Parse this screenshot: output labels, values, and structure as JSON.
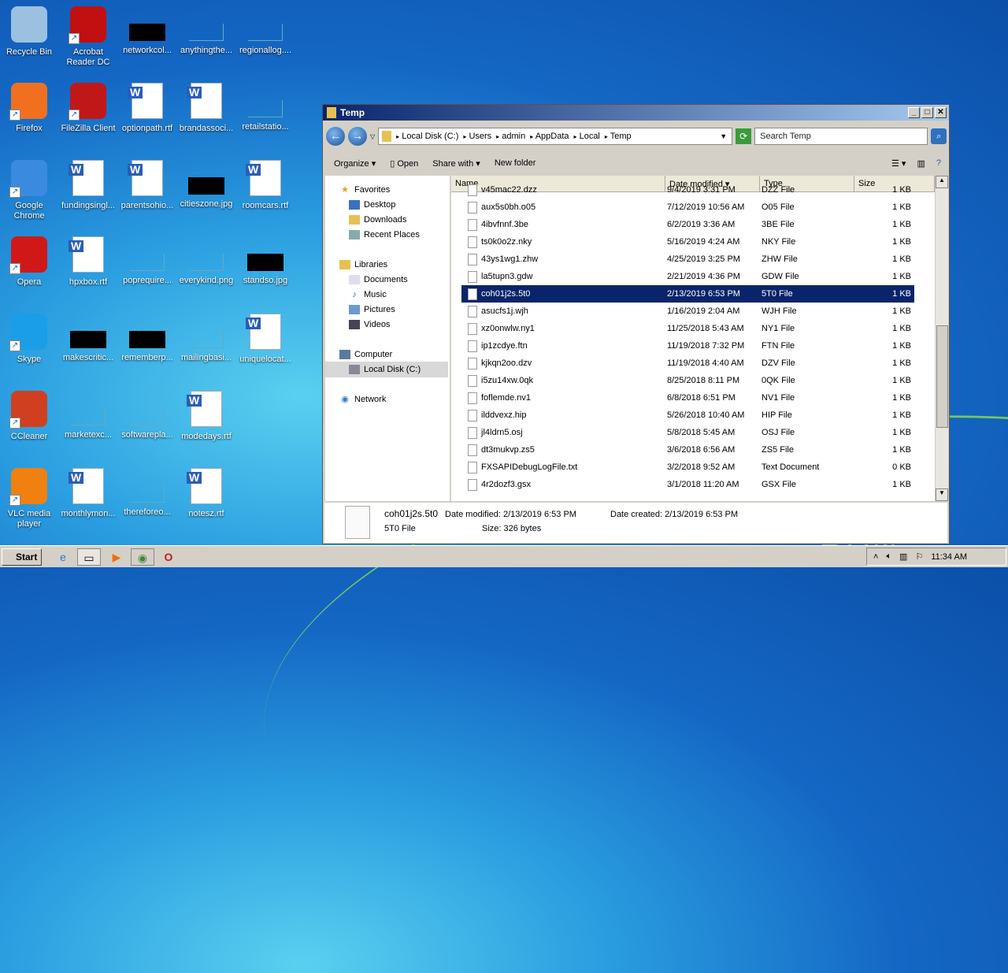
{
  "desktop": {
    "icons": [
      {
        "label": "Recycle Bin",
        "kind": "app",
        "color": "#9cc0e0"
      },
      {
        "label": "Acrobat Reader DC",
        "kind": "app",
        "color": "#c01010",
        "shortcut": true
      },
      {
        "label": "networkcol...",
        "kind": "black"
      },
      {
        "label": "anythingthe...",
        "kind": "blank"
      },
      {
        "label": "regionallog....",
        "kind": "blank"
      },
      {
        "label": "Firefox",
        "kind": "app",
        "color": "#f07020",
        "shortcut": true
      },
      {
        "label": "FileZilla Client",
        "kind": "app",
        "color": "#c01818",
        "shortcut": true
      },
      {
        "label": "optionpath.rtf",
        "kind": "doc"
      },
      {
        "label": "brandassoci...",
        "kind": "doc"
      },
      {
        "label": "retailstatio...",
        "kind": "blank"
      },
      {
        "label": "Google Chrome",
        "kind": "app",
        "color": "#3a8ae0",
        "shortcut": true
      },
      {
        "label": "fundingsingl...",
        "kind": "doc"
      },
      {
        "label": "parentsohio...",
        "kind": "doc"
      },
      {
        "label": "citieszone.jpg",
        "kind": "black"
      },
      {
        "label": "roomcars.rtf",
        "kind": "doc"
      },
      {
        "label": "Opera",
        "kind": "app",
        "color": "#d01818",
        "shortcut": true
      },
      {
        "label": "hpxbox.rtf",
        "kind": "doc"
      },
      {
        "label": "poprequire...",
        "kind": "blank"
      },
      {
        "label": "everykind.png",
        "kind": "blank"
      },
      {
        "label": "standso.jpg",
        "kind": "black"
      },
      {
        "label": "Skype",
        "kind": "app",
        "color": "#1a9ee8",
        "shortcut": true
      },
      {
        "label": "makescritic...",
        "kind": "black"
      },
      {
        "label": "rememberp...",
        "kind": "black"
      },
      {
        "label": "mailingbasi...",
        "kind": "blank"
      },
      {
        "label": "uniquelocat...",
        "kind": "doc"
      },
      {
        "label": "CCleaner",
        "kind": "app",
        "color": "#d04020",
        "shortcut": true
      },
      {
        "label": "marketexc...",
        "kind": "blank"
      },
      {
        "label": "softwarepla...",
        "kind": "blank"
      },
      {
        "label": "modedays.rtf",
        "kind": "doc"
      },
      null,
      {
        "label": "VLC media player",
        "kind": "app",
        "color": "#f08010",
        "shortcut": true
      },
      {
        "label": "monthlymon...",
        "kind": "doc"
      },
      {
        "label": "thereforeo...",
        "kind": "blank"
      },
      {
        "label": "notesz.rtf",
        "kind": "doc"
      },
      null
    ]
  },
  "window": {
    "title": "Temp",
    "breadcrumb": [
      "Local Disk (C:)",
      "Users",
      "admin",
      "AppData",
      "Local",
      "Temp"
    ],
    "search_placeholder": "Search Temp",
    "toolbar": {
      "organize": "Organize",
      "open": "Open",
      "share": "Share with",
      "new_folder": "New folder"
    },
    "nav": {
      "favorites": "Favorites",
      "desktop": "Desktop",
      "downloads": "Downloads",
      "recent": "Recent Places",
      "libraries": "Libraries",
      "documents": "Documents",
      "music": "Music",
      "pictures": "Pictures",
      "videos": "Videos",
      "computer": "Computer",
      "local_disk": "Local Disk (C:)",
      "network": "Network"
    },
    "columns": {
      "name": "Name",
      "date": "Date modified",
      "type": "Type",
      "size": "Size"
    },
    "files": [
      [
        "v45mac22.dzz",
        "9/4/2019 3:31 PM",
        "DZZ File",
        "1 KB"
      ],
      [
        "aux5s0bh.o05",
        "7/12/2019 10:56 AM",
        "O05 File",
        "1 KB"
      ],
      [
        "4ibvfnnf.3be",
        "6/2/2019 3:36 AM",
        "3BE File",
        "1 KB"
      ],
      [
        "ts0k0o2z.nky",
        "5/16/2019 4:24 AM",
        "NKY File",
        "1 KB"
      ],
      [
        "43ys1wg1.zhw",
        "4/25/2019 3:25 PM",
        "ZHW File",
        "1 KB"
      ],
      [
        "la5tupn3.gdw",
        "2/21/2019 4:36 PM",
        "GDW File",
        "1 KB"
      ],
      [
        "coh01j2s.5t0",
        "2/13/2019 6:53 PM",
        "5T0 File",
        "1 KB"
      ],
      [
        "asucfs1j.wjh",
        "1/16/2019 2:04 AM",
        "WJH File",
        "1 KB"
      ],
      [
        "xz0onwlw.ny1",
        "11/25/2018 5:43 AM",
        "NY1 File",
        "1 KB"
      ],
      [
        "ip1zcdye.ftn",
        "11/19/2018 7:32 PM",
        "FTN File",
        "1 KB"
      ],
      [
        "kjkqn2oo.dzv",
        "11/19/2018 4:40 AM",
        "DZV File",
        "1 KB"
      ],
      [
        "i5zu14xw.0qk",
        "8/25/2018 8:11 PM",
        "0QK File",
        "1 KB"
      ],
      [
        "foflemde.nv1",
        "6/8/2018 6:51 PM",
        "NV1 File",
        "1 KB"
      ],
      [
        "ilddvexz.hip",
        "5/26/2018 10:40 AM",
        "HIP File",
        "1 KB"
      ],
      [
        "jl4ldrn5.osj",
        "5/8/2018 5:45 AM",
        "OSJ File",
        "1 KB"
      ],
      [
        "dt3mukvp.zs5",
        "3/6/2018 6:56 AM",
        "ZS5 File",
        "1 KB"
      ],
      [
        "FXSAPIDebugLogFile.txt",
        "3/2/2018 9:52 AM",
        "Text Document",
        "0 KB"
      ],
      [
        "4r2dozf3.gsx",
        "3/1/2018 11:20 AM",
        "GSX File",
        "1 KB"
      ]
    ],
    "selected_index": 6,
    "details": {
      "name": "coh01j2s.5t0",
      "modified": "Date modified: 2/13/2019 6:53 PM",
      "created": "Date created: 2/13/2019 6:53 PM",
      "type": "5T0 File",
      "size": "Size: 326 bytes"
    }
  },
  "taskbar": {
    "start": "Start",
    "clock": "11:34 AM"
  },
  "watermark": "ANY RUN",
  "colors": {
    "selection": "#0a246a"
  }
}
